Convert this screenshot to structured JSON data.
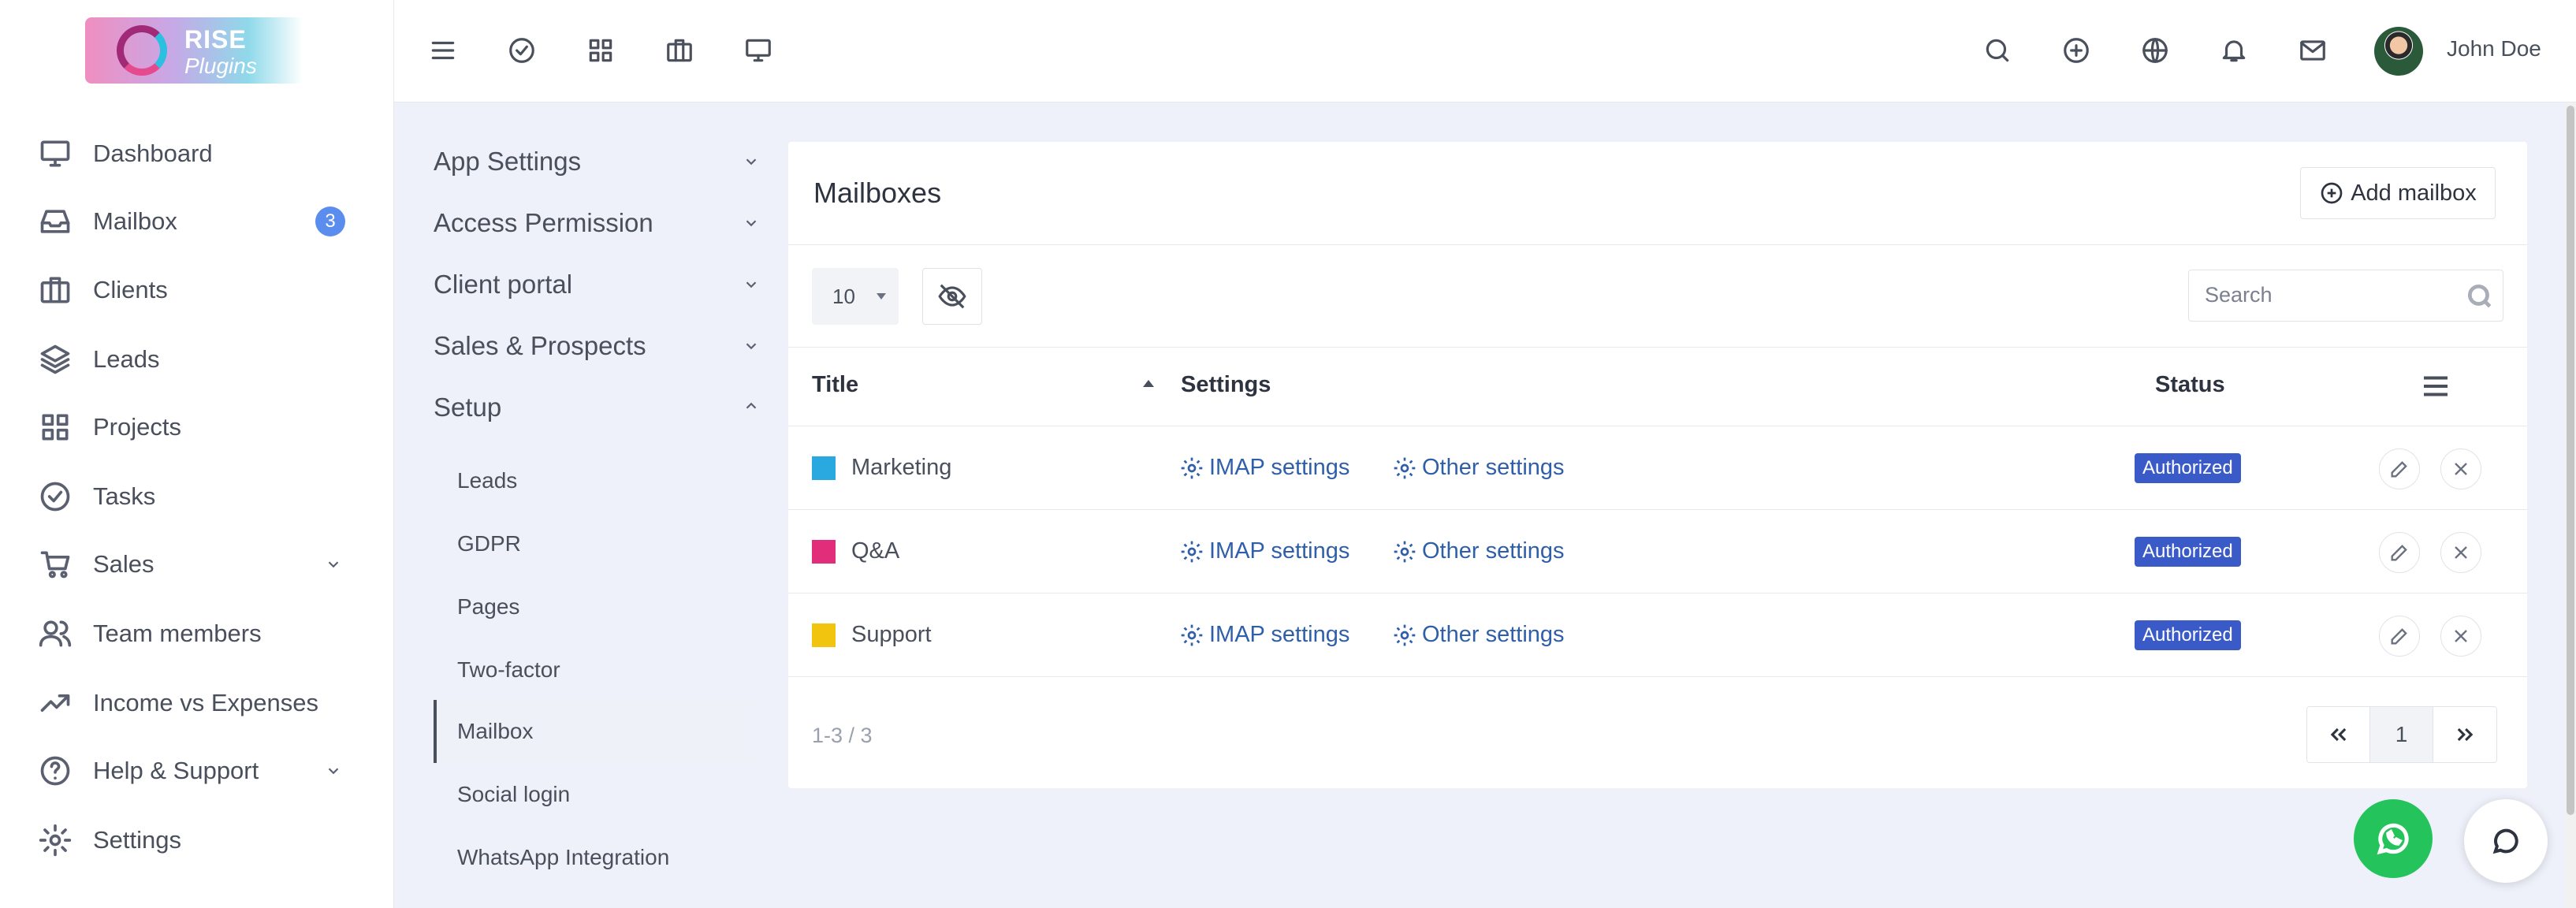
{
  "brand": {
    "line1": "RISE",
    "line2": "Plugins"
  },
  "header": {
    "user_name": "John Doe",
    "left_icons": [
      "menu-icon",
      "check-circle-icon",
      "grid-icon",
      "briefcase-icon",
      "monitor-icon"
    ],
    "right_icons": [
      "search-icon",
      "plus-circle-icon",
      "globe-icon",
      "bell-icon",
      "mail-icon"
    ]
  },
  "sidebar": {
    "items": [
      {
        "label": "Dashboard",
        "icon": "monitor-icon"
      },
      {
        "label": "Mailbox",
        "icon": "inbox-icon",
        "badge": "3"
      },
      {
        "label": "Clients",
        "icon": "briefcase-icon"
      },
      {
        "label": "Leads",
        "icon": "layers-icon"
      },
      {
        "label": "Projects",
        "icon": "grid-icon"
      },
      {
        "label": "Tasks",
        "icon": "check-circle-icon"
      },
      {
        "label": "Sales",
        "icon": "cart-icon",
        "expandable": true
      },
      {
        "label": "Team members",
        "icon": "users-icon"
      },
      {
        "label": "Income vs Expenses",
        "icon": "trending-up-icon"
      },
      {
        "label": "Help & Support",
        "icon": "help-circle-icon",
        "expandable": true
      },
      {
        "label": "Settings",
        "icon": "gear-icon"
      }
    ]
  },
  "settings_menu": {
    "sections": [
      {
        "label": "App Settings",
        "expanded": false
      },
      {
        "label": "Access Permission",
        "expanded": false
      },
      {
        "label": "Client portal",
        "expanded": false
      },
      {
        "label": "Sales & Prospects",
        "expanded": false
      },
      {
        "label": "Setup",
        "expanded": true
      }
    ],
    "setup_items": [
      "Leads",
      "GDPR",
      "Pages",
      "Two-factor",
      "Mailbox",
      "Social login",
      "WhatsApp Integration"
    ],
    "active_item": "Mailbox"
  },
  "card": {
    "title": "Mailboxes",
    "add_button": "Add mailbox",
    "page_size": "10",
    "search_placeholder": "Search",
    "columns": {
      "title": "Title",
      "settings": "Settings",
      "status": "Status"
    },
    "rows": [
      {
        "title": "Marketing",
        "color": "#29a9e0",
        "imap": "IMAP settings",
        "other": "Other settings",
        "status": "Authorized"
      },
      {
        "title": "Q&A",
        "color": "#e22d7b",
        "imap": "IMAP settings",
        "other": "Other settings",
        "status": "Authorized"
      },
      {
        "title": "Support",
        "color": "#f1c40f",
        "imap": "IMAP settings",
        "other": "Other settings",
        "status": "Authorized"
      }
    ],
    "summary": "1-3 / 3",
    "pagination": {
      "current": "1"
    }
  },
  "colors": {
    "accent": "#3a5bc7",
    "link": "#2f5fa8",
    "whatsapp": "#25c35c",
    "badge": "#5b8def"
  }
}
